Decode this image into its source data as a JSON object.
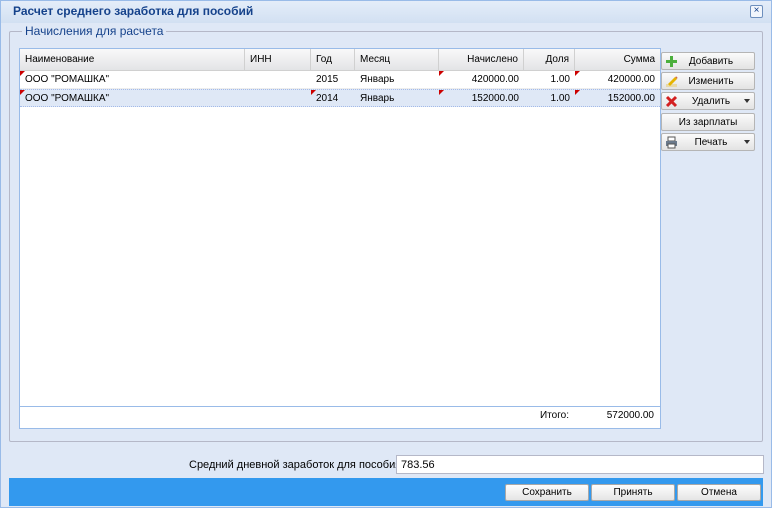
{
  "window": {
    "title": "Расчет среднего заработка для пособий",
    "close": "×"
  },
  "fieldset": {
    "legend": "Начисления для расчета"
  },
  "grid": {
    "columns": [
      "Наименование",
      "ИНН",
      "Год",
      "Месяц",
      "Начислено",
      "Доля",
      "Сумма"
    ],
    "rows": [
      {
        "name": "ООО \"РОМАШКА\"",
        "inn": "",
        "year": "2015",
        "month": "Январь",
        "accrued": "420000.00",
        "share": "1.00",
        "sum": "420000.00"
      },
      {
        "name": "ООО \"РОМАШКА\"",
        "inn": "",
        "year": "2014",
        "month": "Январь",
        "accrued": "152000.00",
        "share": "1.00",
        "sum": "152000.00"
      }
    ],
    "total_label": "Итого:",
    "total_value": "572000.00"
  },
  "side_buttons": {
    "add": "Добавить",
    "edit": "Изменить",
    "delete": "Удалить",
    "from_salary": "Из зарплаты",
    "print": "Печать"
  },
  "avg": {
    "label": "Средний дневной заработок для пособия:",
    "value": "783.56"
  },
  "footer": {
    "save": "Сохранить",
    "accept": "Принять",
    "cancel": "Отмена"
  },
  "colors": {
    "accent": "#3399ee",
    "title": "#15428b",
    "selection": "#dfe8f6"
  }
}
